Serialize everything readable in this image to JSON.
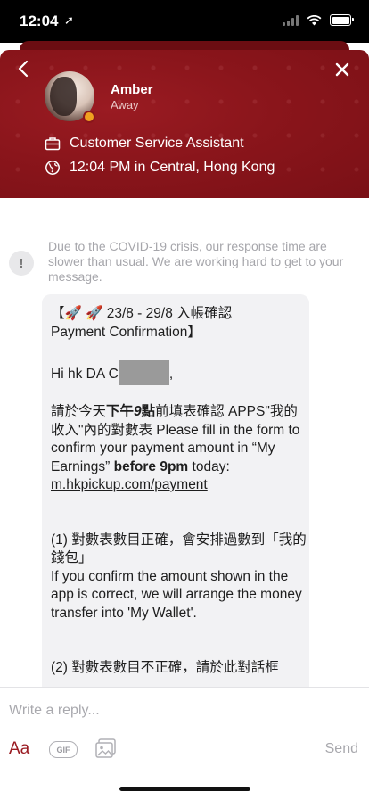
{
  "status_bar": {
    "time": "12:04",
    "location_arrow": "➚"
  },
  "header": {
    "agent_name": "Amber",
    "agent_status": "Away",
    "role": "Customer Service Assistant",
    "local_time": "12:04 PM in Central, Hong Kong",
    "accent_color": "#8a151b",
    "presence_color": "#f0a020"
  },
  "notice": {
    "icon": "!",
    "text": "Due to the COVID-19 crisis, our response time are slower than usual. We are working hard to get to your message."
  },
  "message": {
    "line1": "【🚀 🚀 23/8 - 29/8 入帳確認",
    "line2": "Payment Confirmation】",
    "greeting": "Hi hk DA C",
    "greeting_end": ",",
    "p1_a": "請於今天",
    "p1_b": "下午",
    "p1_c": "9",
    "p1_d": "點",
    "p1_e": "前填表確認 APPS\"我的收入\"內的對數表 Please fill in the form to confirm your payment amount in “My Earnings” ",
    "p1_f": "before 9pm",
    "p1_g": " today:",
    "link": "m.hkpickup.com/payment",
    "p2": "(1) 對數表數目正確，會安排過數到「我的錢包」",
    "p3": "If you confirm the amount shown in the app is correct, we will arrange the money transfer into 'My Wallet'.",
    "p4": "(2) 對數表數目不正確，請於此對話框"
  },
  "composer": {
    "placeholder": "Write a reply...",
    "text_format_label": "Aa",
    "gif_label": "GIF",
    "send_label": "Send"
  },
  "icons": {
    "back": "chevron-left-icon",
    "close": "close-icon",
    "role": "briefcase-icon",
    "location": "globe-icon",
    "image": "image-icon"
  }
}
